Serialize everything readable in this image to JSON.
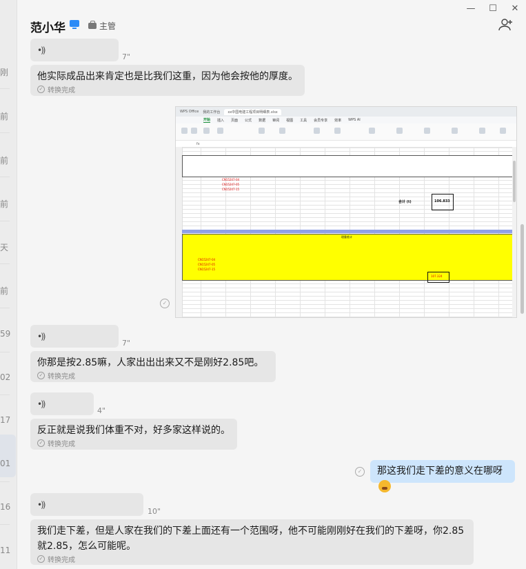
{
  "sidebar": {
    "fragments": [
      "刚",
      "前",
      "前",
      "前",
      "天",
      "前",
      "59",
      "02",
      "17",
      "01",
      "16",
      "11"
    ]
  },
  "window": {
    "minimize": "—",
    "maximize": "☐",
    "close": "✕"
  },
  "header": {
    "name": "范小华",
    "role": "主管",
    "add_member_icon": "⁺👤"
  },
  "messages": [
    {
      "type": "voice",
      "duration": "7\"",
      "text": "他实际成品出来肯定也是比我们这重，因为他会按他的厚度。",
      "status": "转换完成"
    },
    {
      "type": "image"
    },
    {
      "type": "voice",
      "duration": "7\"",
      "text": "你那是按2.85嘛，人家出出出来又不是刚好2.85吧。",
      "status": "转换完成"
    },
    {
      "type": "voice",
      "duration": "4\"",
      "text": "反正就是说我们体重不对，好多家这样说的。",
      "status": "转换完成"
    },
    {
      "type": "text_out",
      "text": "那这我们走下差的意义在哪呀"
    },
    {
      "type": "voice",
      "duration": "10\"",
      "text": "我们走下差，但是人家在我们的下差上面还有一个范围呀，他不可能刚刚好在我们的下差呀，你2.85就2.85，怎么可能呢。",
      "status": "转换完成"
    }
  ],
  "sheet": {
    "tabs": [
      "WPS Office",
      "我的工作台",
      "xx中国电建工程项目明细表.xlsx"
    ],
    "menu": [
      "开始",
      "插入",
      "页面",
      "公式",
      "数据",
      "审阅",
      "视图",
      "工具",
      "会员专享",
      "效率",
      "WPS AI"
    ],
    "rows": [
      "CN15247-04",
      "CN15247-05",
      "CN15247-15"
    ],
    "total_top": "106.833",
    "total_label": "合计 (t)",
    "total_bottom": "107.324",
    "yellow_title": "理重差计"
  }
}
